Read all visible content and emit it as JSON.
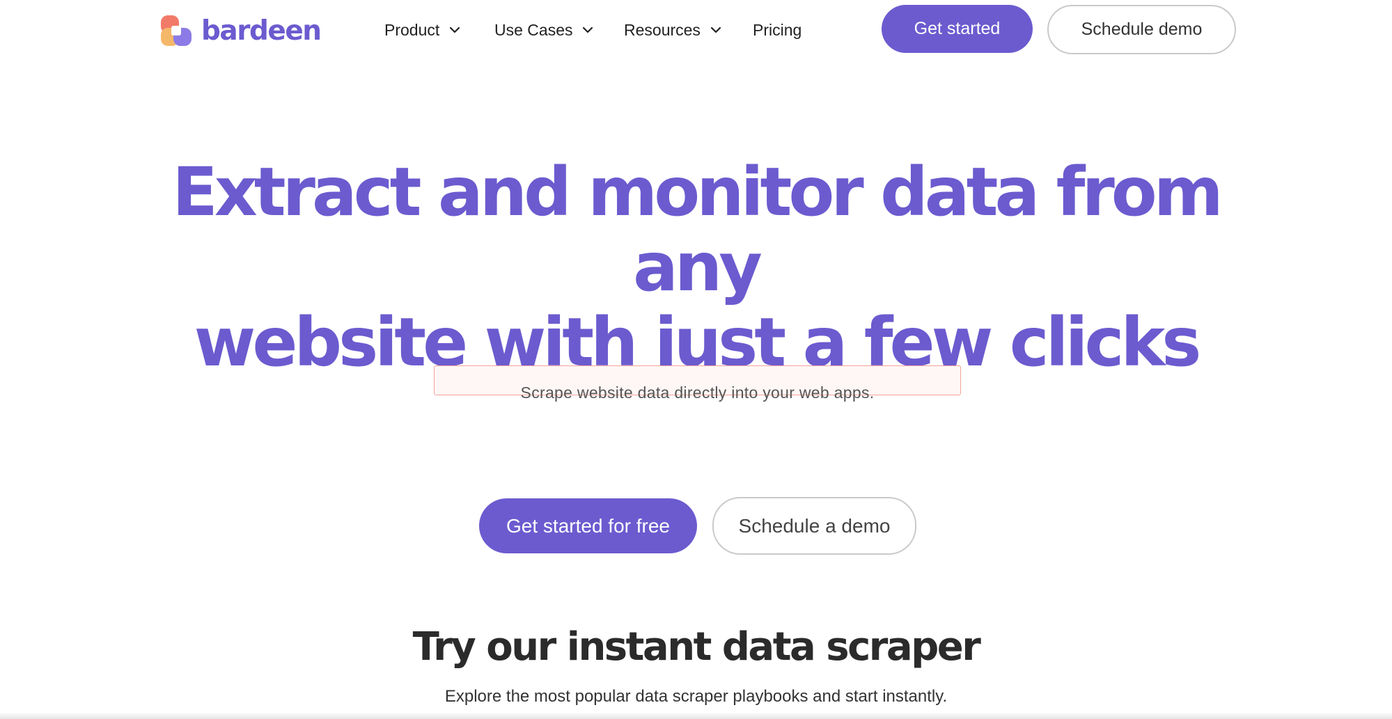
{
  "brand": {
    "name": "bardeen",
    "color": "#6b5bcf",
    "logo_colors": [
      "#f27a68",
      "#f5b86b",
      "#8c7be6",
      "#6b5bcf"
    ]
  },
  "header": {
    "nav": [
      {
        "label": "Product",
        "has_dropdown": true,
        "icon": "chevron-down-icon"
      },
      {
        "label": "Use Cases",
        "has_dropdown": true,
        "icon": "chevron-down-icon"
      },
      {
        "label": "Resources",
        "has_dropdown": true,
        "icon": "chevron-down-icon"
      },
      {
        "label": "Pricing",
        "has_dropdown": false
      }
    ],
    "get_started_label": "Get started",
    "schedule_demo_label": "Schedule demo"
  },
  "hero": {
    "title_line1": "Extract and monitor data from any",
    "title_line2": "website with just a few clicks",
    "subtitle": "Scrape website data directly into your web apps.",
    "cta_primary_label": "Get started for free",
    "cta_secondary_label": "Schedule a demo"
  },
  "section": {
    "title": "Try our instant data scraper",
    "subtitle": "Explore the most popular data scraper playbooks and start instantly."
  }
}
